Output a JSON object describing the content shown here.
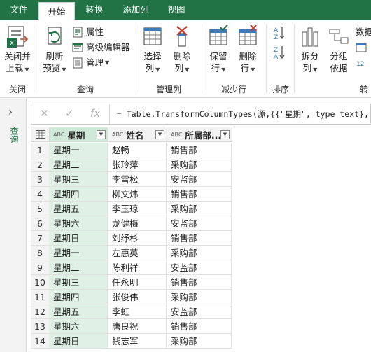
{
  "tabs": [
    {
      "label": "文件",
      "active": false
    },
    {
      "label": "开始",
      "active": true
    },
    {
      "label": "转换",
      "active": false
    },
    {
      "label": "添加列",
      "active": false
    },
    {
      "label": "视图",
      "active": false
    }
  ],
  "ribbon": {
    "close_load": {
      "line1": "关闭并",
      "line2": "上载"
    },
    "refresh": {
      "line1": "刷新",
      "line2": "预览"
    },
    "properties": "属性",
    "advanced_editor": "高级编辑器",
    "manage": "管理",
    "choose_cols": {
      "line1": "选择",
      "line2": "列"
    },
    "remove_cols": {
      "line1": "删除",
      "line2": "列"
    },
    "keep_rows": {
      "line1": "保留",
      "line2": "行"
    },
    "remove_rows": {
      "line1": "删除",
      "line2": "行"
    },
    "split": {
      "line1": "拆分",
      "line2": "列"
    },
    "group_by": {
      "line1": "分组",
      "line2": "依据"
    },
    "datatype": "数据",
    "groups": {
      "close": "关闭",
      "query": "查询",
      "manage_cols": "管理列",
      "reduce_rows": "减少行",
      "sort": "排序",
      "transform": "转"
    }
  },
  "left_pane": {
    "expand_glyph": "›",
    "label": "查询"
  },
  "formula": "= Table.TransformColumnTypes(源,{{\"星期\", type text}, {\"",
  "columns": [
    {
      "type": "ABC",
      "name": "星期"
    },
    {
      "type": "ABC",
      "name": "姓名"
    },
    {
      "type": "ABC",
      "name": "所属部..."
    }
  ],
  "rows": [
    [
      "1",
      "星期一",
      "赵畅",
      "销售部"
    ],
    [
      "2",
      "星期二",
      "张玲萍",
      "采购部"
    ],
    [
      "3",
      "星期三",
      "李雪松",
      "安监部"
    ],
    [
      "4",
      "星期四",
      "柳文炜",
      "销售部"
    ],
    [
      "5",
      "星期五",
      "李玉琼",
      "采购部"
    ],
    [
      "6",
      "星期六",
      "龙健梅",
      "安监部"
    ],
    [
      "7",
      "星期日",
      "刘纾杉",
      "销售部"
    ],
    [
      "8",
      "星期一",
      "左惠英",
      "采购部"
    ],
    [
      "9",
      "星期二",
      "陈利祥",
      "安监部"
    ],
    [
      "10",
      "星期三",
      "任永明",
      "销售部"
    ],
    [
      "11",
      "星期四",
      "张俊伟",
      "采购部"
    ],
    [
      "12",
      "星期五",
      "李虹",
      "安监部"
    ],
    [
      "13",
      "星期六",
      "唐良祝",
      "销售部"
    ],
    [
      "14",
      "星期日",
      "钱志军",
      "采购部"
    ]
  ],
  "colors": {
    "accent": "#217346",
    "selected_col": "#dff0e5"
  }
}
